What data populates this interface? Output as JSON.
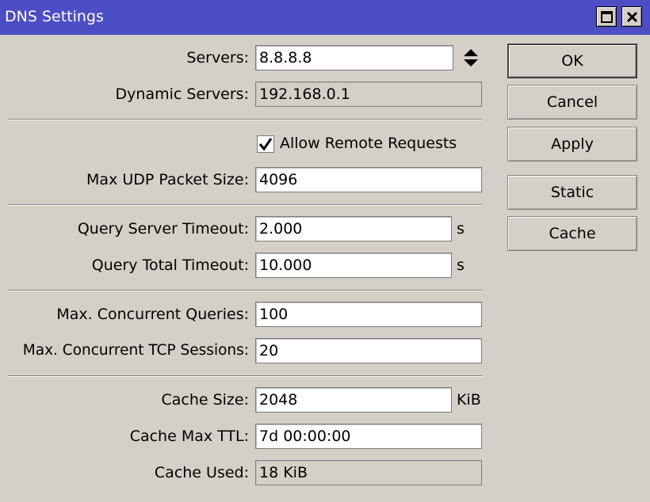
{
  "window": {
    "title": "DNS Settings"
  },
  "fields": {
    "servers": {
      "label": "Servers:",
      "value": "8.8.8.8"
    },
    "dynamic_servers": {
      "label": "Dynamic Servers:",
      "value": "192.168.0.1"
    },
    "allow_remote": {
      "label": "Allow Remote Requests",
      "checked": true
    },
    "max_udp": {
      "label": "Max UDP Packet Size:",
      "value": "4096"
    },
    "query_server_timeout": {
      "label": "Query Server Timeout:",
      "value": "2.000",
      "unit": "s"
    },
    "query_total_timeout": {
      "label": "Query Total Timeout:",
      "value": "10.000",
      "unit": "s"
    },
    "max_concurrent_queries": {
      "label": "Max. Concurrent Queries:",
      "value": "100"
    },
    "max_concurrent_tcp": {
      "label": "Max. Concurrent TCP Sessions:",
      "value": "20"
    },
    "cache_size": {
      "label": "Cache Size:",
      "value": "2048",
      "unit": "KiB"
    },
    "cache_max_ttl": {
      "label": "Cache Max TTL:",
      "value": "7d 00:00:00"
    },
    "cache_used": {
      "label": "Cache Used:",
      "value": "18 KiB"
    }
  },
  "buttons": {
    "ok": "OK",
    "cancel": "Cancel",
    "apply": "Apply",
    "static": "Static",
    "cache": "Cache"
  },
  "icons": {
    "maximize": "maximize-icon",
    "close": "close-icon",
    "spinner": "up-down-arrows-icon",
    "check": "checkmark-icon"
  },
  "colors": {
    "titlebar": "#4d4dc6",
    "background": "#d4d0c8"
  }
}
